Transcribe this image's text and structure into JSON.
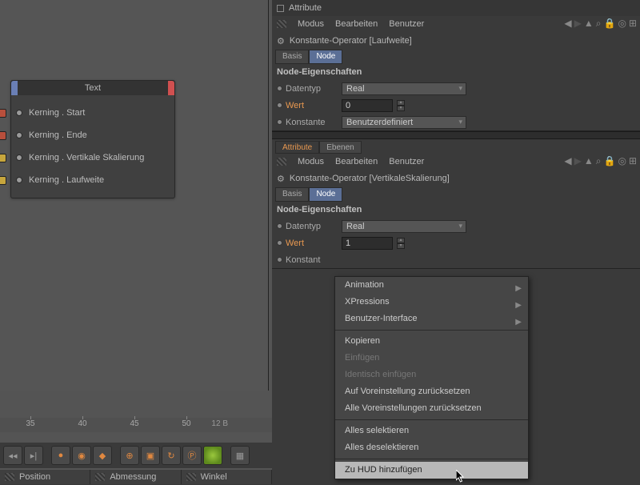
{
  "node": {
    "title": "Text",
    "ports": [
      {
        "label": "Kerning . Start",
        "color": "red"
      },
      {
        "label": "Kerning . Ende",
        "color": "red"
      },
      {
        "label": "Kerning . Vertikale Skalierung",
        "color": "yellow"
      },
      {
        "label": "Kerning . Laufweite",
        "color": "yellow"
      }
    ]
  },
  "ruler": {
    "ticks": [
      "35",
      "40",
      "45",
      "50"
    ],
    "frame": "12 B"
  },
  "status": {
    "cells": [
      "Position",
      "Abmessung",
      "Winkel"
    ]
  },
  "panel1": {
    "title": "Attribute",
    "menu": [
      "Modus",
      "Bearbeiten",
      "Benutzer"
    ],
    "operator": "Konstante-Operator [Laufweite]",
    "tabs": [
      "Basis",
      "Node"
    ],
    "section": "Node-Eigenschaften",
    "props": {
      "datentyp_label": "Datentyp",
      "datentyp": "Real",
      "wert_label": "Wert",
      "wert": "0",
      "konstante_label": "Konstante",
      "konstante": "Benutzerdefiniert"
    }
  },
  "panel2": {
    "tabs_top": [
      "Attribute",
      "Ebenen"
    ],
    "menu": [
      "Modus",
      "Bearbeiten",
      "Benutzer"
    ],
    "operator": "Konstante-Operator [VertikaleSkalierung]",
    "tabs": [
      "Basis",
      "Node"
    ],
    "section": "Node-Eigenschaften",
    "props": {
      "datentyp_label": "Datentyp",
      "datentyp": "Real",
      "wert_label": "Wert",
      "wert": "1",
      "konstante_label": "Konstant"
    }
  },
  "ctx": {
    "items": [
      {
        "label": "Animation",
        "sub": true
      },
      {
        "label": "XPressions",
        "sub": true
      },
      {
        "label": "Benutzer-Interface",
        "sub": true
      },
      {
        "sep": true
      },
      {
        "label": "Kopieren"
      },
      {
        "label": "Einfügen",
        "disabled": true
      },
      {
        "label": "Identisch einfügen",
        "disabled": true
      },
      {
        "label": "Auf Voreinstellung zurücksetzen"
      },
      {
        "label": "Alle Voreinstellungen zurücksetzen"
      },
      {
        "sep": true
      },
      {
        "label": "Alles selektieren"
      },
      {
        "label": "Alles deselektieren"
      },
      {
        "sep": true
      },
      {
        "label": "Zu HUD hinzufügen",
        "hover": true
      }
    ]
  }
}
